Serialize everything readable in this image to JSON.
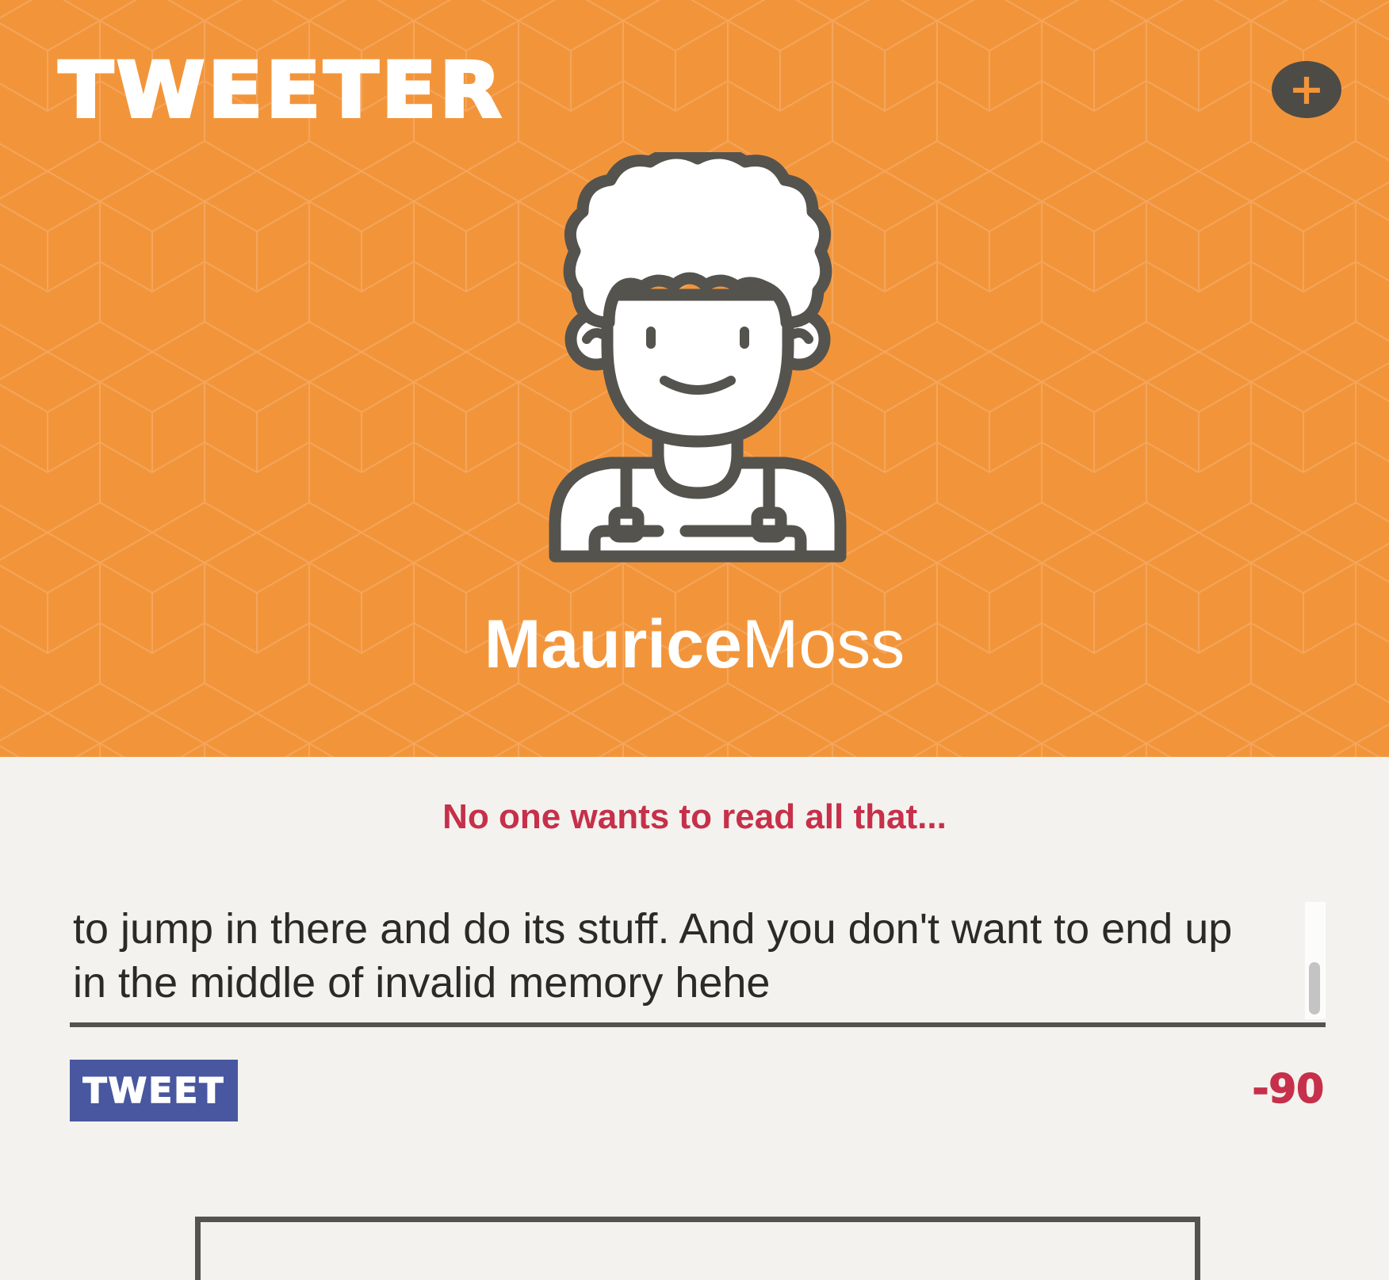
{
  "app": {
    "logo": "TWEETER",
    "add_button_glyph": "+"
  },
  "profile": {
    "avatar_icon": "curly-hair-person-icon",
    "first_name": "Maurice",
    "last_name": "Moss"
  },
  "composer": {
    "warning": "No one wants to read all that...",
    "text": "to jump in there and do its stuff. And you don't want to end up\nin the middle of invalid memory hehe",
    "tweet_label": "TWEET",
    "remaining": "-90"
  },
  "colors": {
    "header_orange": "#f2953a",
    "dark": "#4d4b46",
    "warning_red": "#c6304a",
    "button_blue": "#48579f",
    "background": "#f4f2ee"
  }
}
